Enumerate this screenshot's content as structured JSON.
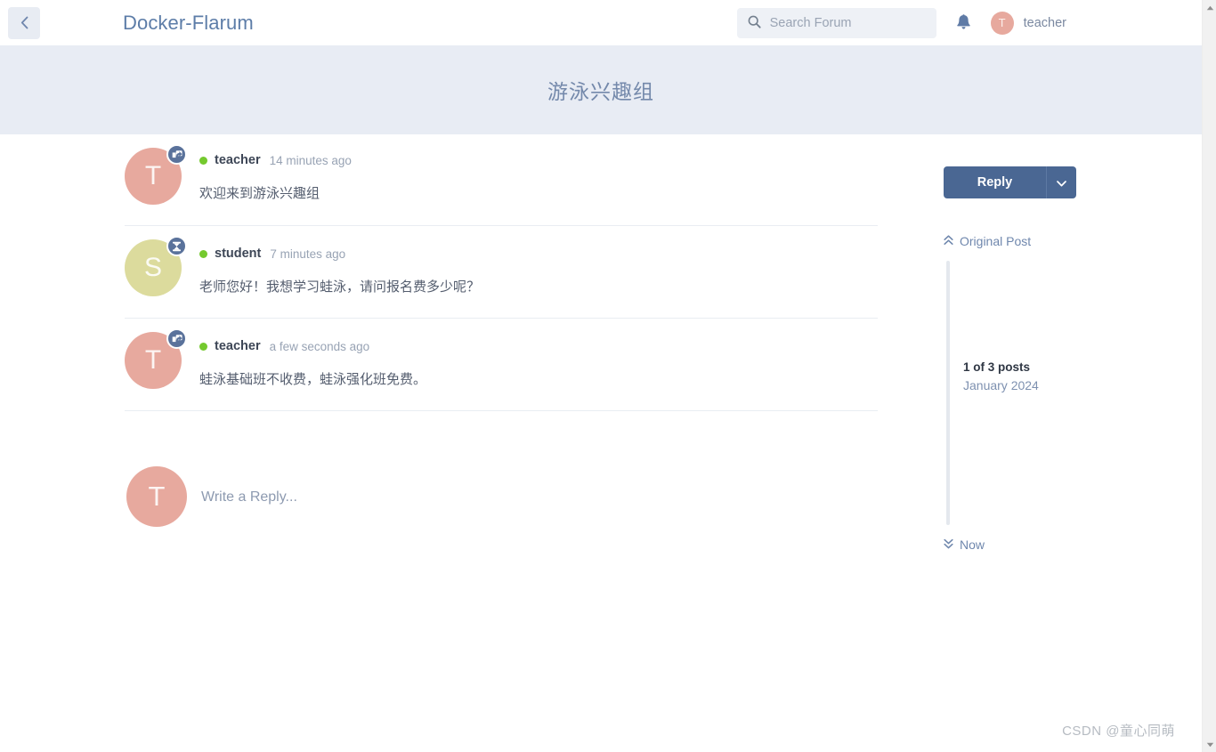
{
  "header": {
    "back_icon": "chevron-left-icon",
    "brand_title": "Docker-Flarum",
    "search": {
      "icon": "search-icon",
      "placeholder": "Search Forum",
      "value": ""
    },
    "notifications_icon": "bell-icon",
    "user": {
      "avatar_initial": "T",
      "name": "teacher",
      "avatar_color": "#e7a99e"
    }
  },
  "hero": {
    "title": "游泳兴趣组",
    "background": "#e8ecf4",
    "title_color": "#7489ab"
  },
  "posts": [
    {
      "avatar_initial": "T",
      "avatar_color": "#e7a99e",
      "badge_icon": "reply-badge-icon",
      "online": true,
      "username": "teacher",
      "time": "14 minutes ago",
      "body": "欢迎来到游泳兴趣组"
    },
    {
      "avatar_initial": "S",
      "avatar_color": "#dcdb9d",
      "badge_icon": "hourglass-badge-icon",
      "online": true,
      "username": "student",
      "time": "7 minutes ago",
      "body": "老师您好！我想学习蛙泳，请问报名费多少呢？"
    },
    {
      "avatar_initial": "T",
      "avatar_color": "#e7a99e",
      "badge_icon": "reply-badge-icon",
      "online": true,
      "username": "teacher",
      "time": "a few seconds ago",
      "body": "蛙泳基础班不收费，蛙泳强化班免费。"
    }
  ],
  "composer": {
    "avatar_initial": "T",
    "avatar_color": "#e7a99e",
    "placeholder": "Write a Reply..."
  },
  "sidebar": {
    "reply_label": "Reply",
    "reply_caret_icon": "chevron-down-icon",
    "reply_button_color": "#4a6793",
    "scrubber": {
      "top_label": "Original Post",
      "top_icon": "chevrons-up-icon",
      "count_label": "1 of 3 posts",
      "date_label": "January 2024",
      "bottom_label": "Now",
      "bottom_icon": "chevrons-down-icon"
    }
  },
  "watermark": {
    "text": "CSDN @童心同萌"
  },
  "scrollbar": {
    "up_icon": "scroll-up-arrow-icon",
    "down_icon": "scroll-down-arrow-icon"
  }
}
